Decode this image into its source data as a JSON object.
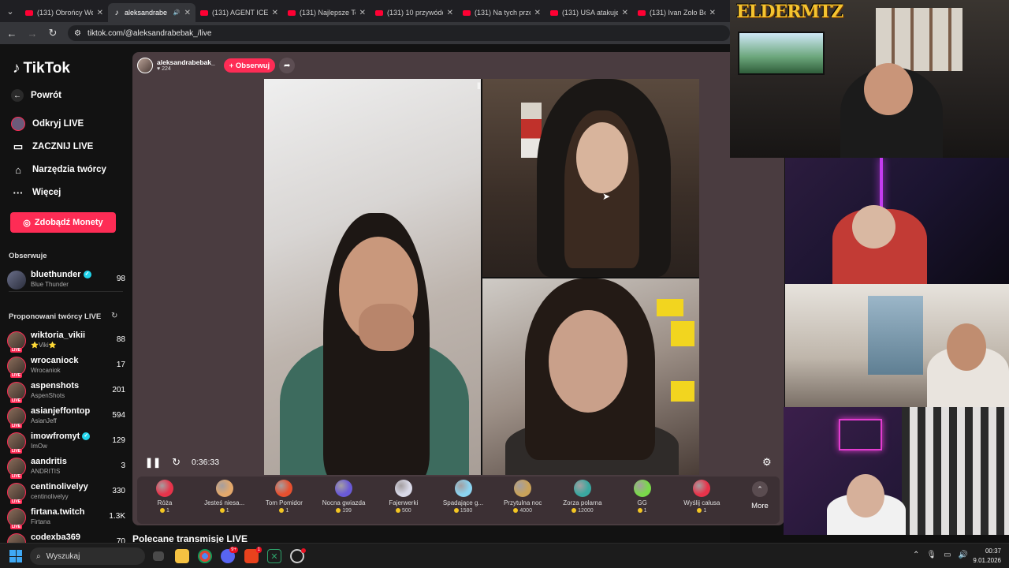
{
  "browser": {
    "tabs": [
      {
        "title": "(131) Obrońcy We",
        "type": "youtube",
        "active": false
      },
      {
        "title": "aleksandrabe",
        "type": "tiktok",
        "active": true
      },
      {
        "title": "(131) AGENT ICE",
        "type": "youtube",
        "active": false
      },
      {
        "title": "(131) Najlepsze Te",
        "type": "youtube",
        "active": false
      },
      {
        "title": "(131) 10 przywódc",
        "type": "youtube",
        "active": false
      },
      {
        "title": "(131) Na tych prze",
        "type": "youtube",
        "active": false
      },
      {
        "title": "(131) USA atakuje",
        "type": "youtube",
        "active": false
      },
      {
        "title": "(131) Ivan Zolo Be",
        "type": "youtube",
        "active": false
      }
    ],
    "url": "tiktok.com/@aleksandrabebak_/live"
  },
  "sidebar": {
    "logo": "TikTok",
    "back": "Powrót",
    "nav": [
      {
        "label": "Odkryj LIVE",
        "icon": "live-discover-icon"
      },
      {
        "label": "ZACZNIJ LIVE",
        "icon": "camera-icon"
      },
      {
        "label": "Narzędzia twórcy",
        "icon": "home-icon"
      },
      {
        "label": "Więcej",
        "icon": "more-dots-icon"
      }
    ],
    "coins_button": "Zdobądź Monety",
    "following_header": "Obserwuje",
    "following": [
      {
        "name": "bluethunder",
        "sub": "Blue Thunder",
        "count": "98",
        "verified": true
      }
    ],
    "suggested_header": "Proponowani twórcy LIVE",
    "suggested": [
      {
        "name": "wiktoria_vikii",
        "sub": "⭐Viki⭐",
        "count": "88",
        "verified": false
      },
      {
        "name": "wrocaniock",
        "sub": "Wrocaniok",
        "count": "17",
        "verified": false
      },
      {
        "name": "aspenshots",
        "sub": "AspenShots",
        "count": "201",
        "verified": false
      },
      {
        "name": "asianjeffontop",
        "sub": "AsianJeff",
        "count": "594",
        "verified": false
      },
      {
        "name": "imowfromyt",
        "sub": "ImOw",
        "count": "129",
        "verified": true
      },
      {
        "name": "aandritis",
        "sub": "ANDRITIS",
        "count": "3",
        "verified": false
      },
      {
        "name": "centinolivelyy",
        "sub": "centinolivelyy",
        "count": "330",
        "verified": false
      },
      {
        "name": "firtana.twitch",
        "sub": "Firtana",
        "count": "1.3K",
        "verified": false
      },
      {
        "name": "codexba369",
        "sub": "",
        "count": "70",
        "verified": false
      }
    ],
    "live_tag": "LIVE"
  },
  "live": {
    "host_name": "aleksandrabebak_",
    "host_likes": "224",
    "follow_button": "+ Obserwuj",
    "elapsed": "0:36:33",
    "gifts": [
      {
        "name": "Róża",
        "price": "1",
        "color": "#e8334a"
      },
      {
        "name": "Jesteś niesa...",
        "price": "1",
        "color": "#e3a86b"
      },
      {
        "name": "Tom Pomidor",
        "price": "1",
        "color": "#e8502f"
      },
      {
        "name": "Nocna gwiazda",
        "price": "199",
        "color": "#6a5ad8"
      },
      {
        "name": "Fajerwerki",
        "price": "500",
        "color": "#d9d9e8"
      },
      {
        "name": "Spadające g...",
        "price": "1580",
        "color": "#8bd3f0"
      },
      {
        "name": "Przytulna noc",
        "price": "4000",
        "color": "#c9a25a"
      },
      {
        "name": "Zorza polarna",
        "price": "12000",
        "color": "#3aa7a0"
      },
      {
        "name": "GG",
        "price": "1",
        "color": "#7ad94a"
      },
      {
        "name": "Wyślij całusa",
        "price": "1",
        "color": "#e8334a"
      }
    ],
    "more": "More",
    "recommended": "Polecane transmisje LIVE"
  },
  "overlay": {
    "brand": "ELDERMTZ"
  },
  "taskbar": {
    "search": "Wyszukaj",
    "badges": {
      "discord": "9+",
      "app": "1"
    },
    "time": "00:37",
    "date": "9.01.2026"
  }
}
